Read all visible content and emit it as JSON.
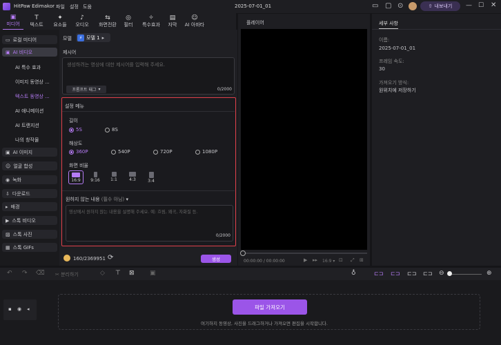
{
  "app": {
    "name": "HitPaw Edimakor",
    "menus": [
      "파일",
      "설정",
      "도움"
    ],
    "doc_title": "2025-07-01_01",
    "export_label": "내보내기"
  },
  "toolbar": {
    "tools": [
      {
        "label": "미디어",
        "icon": "media-icon"
      },
      {
        "label": "텍스트",
        "icon": "text-icon"
      },
      {
        "label": "요소들",
        "icon": "elements-icon"
      },
      {
        "label": "오디오",
        "icon": "audio-icon"
      },
      {
        "label": "화면전환",
        "icon": "transition-icon"
      },
      {
        "label": "필터",
        "icon": "filter-icon"
      },
      {
        "label": "특수효과",
        "icon": "effects-icon"
      },
      {
        "label": "자막",
        "icon": "subtitle-icon"
      },
      {
        "label": "AI 아바타",
        "icon": "avatar-icon"
      }
    ]
  },
  "sidebar": {
    "items": [
      {
        "label": "로컬 미디어"
      },
      {
        "label": "AI 비디오"
      },
      {
        "label": "AI 특수 효과"
      },
      {
        "label": "이미지 동영상 ..."
      },
      {
        "label": "텍스트 동영상 ..."
      },
      {
        "label": "AI 애니메이션"
      },
      {
        "label": "AI 트랜지션"
      },
      {
        "label": "나의 창작물"
      },
      {
        "label": "AI 이미지"
      },
      {
        "label": "얼굴 합성"
      },
      {
        "label": "녹화"
      },
      {
        "label": "다운로드"
      },
      {
        "label": "배경"
      },
      {
        "label": "스톡 비디오"
      },
      {
        "label": "스톡 사진"
      },
      {
        "label": "스톡 GIFs"
      }
    ]
  },
  "panel": {
    "model_label": "모델",
    "model_value": "모델 1",
    "prompt_label": "제시어",
    "prompt_placeholder": "생성하려는 영상에 대한 제시어를 입력해 주세요.",
    "prompt_tag": "프롬프트 태그",
    "prompt_count": "0/2000",
    "settings_title": "설정 메뉴",
    "length_label": "길이",
    "length_options": [
      "5S",
      "8S"
    ],
    "resolution_label": "해상도",
    "resolution_options": [
      "360P",
      "540P",
      "720P",
      "1080P"
    ],
    "ratio_label": "화면 비율",
    "ratio_options": [
      "16:9",
      "9:16",
      "1:1",
      "4:3",
      "3:4"
    ],
    "negative_label": "원하지 않는 내용",
    "negative_optional": "(필수 아님)",
    "negative_placeholder": "영상에서 원하지 않는 내용을 설명해 주세요. 예: 흐림, 왜곡, 자화질 등.",
    "negative_count": "0/2000",
    "credits": "160/2369951",
    "generate": "생성"
  },
  "player": {
    "title": "플레이어",
    "time": "00:00:00 / 00:00:00",
    "ratio": "16:9"
  },
  "details": {
    "tab": "세부 사항",
    "name_label": "이름:",
    "name_value": "2025-07-01_01",
    "fps_label": "프레임 속도:",
    "fps_value": "30",
    "save_label": "가져오기 방식:",
    "save_value": "원위치에 저장하기"
  },
  "timeline": {
    "split_label": "분리하기",
    "import_button": "파일 가져오기",
    "hint": "여기하지 동영상, 사진을 드래그하거나 가져오면 편집을 시작합니다."
  },
  "colors": {
    "accent": "#b67cf5",
    "highlight_border": "#e0404a",
    "button": "#9b55e8"
  }
}
